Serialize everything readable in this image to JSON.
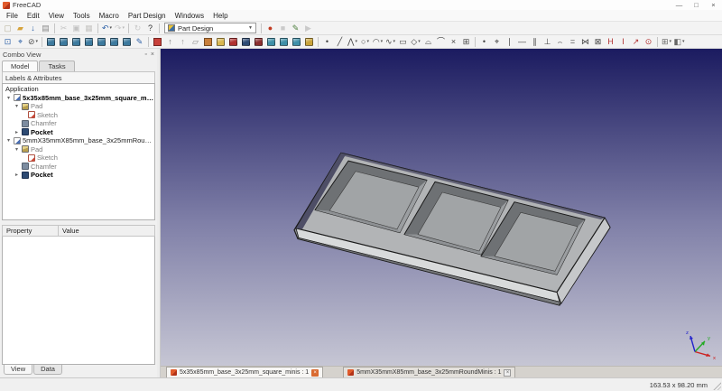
{
  "window": {
    "title": "FreeCAD",
    "controls": {
      "minimize": "—",
      "maximize": "□",
      "close": "×"
    }
  },
  "menu": {
    "items": [
      "File",
      "Edit",
      "View",
      "Tools",
      "Macro",
      "Part Design",
      "Windows",
      "Help"
    ]
  },
  "toolbars": {
    "workbench_value": "Part Design",
    "row1": [
      {
        "name": "new-file",
        "icon": "new-file-icon",
        "glyph": "▢",
        "color": "#b8b29a"
      },
      {
        "name": "open-file",
        "icon": "open-folder-icon",
        "glyph": "▰",
        "color": "#d6a33c"
      },
      {
        "name": "save",
        "icon": "save-icon",
        "glyph": "↓",
        "color": "#2f62a8"
      },
      {
        "name": "print",
        "icon": "print-icon",
        "glyph": "▤",
        "color": "#8a8a8a"
      },
      {
        "sep": true
      },
      {
        "name": "cut",
        "icon": "scissors-icon",
        "glyph": "✂",
        "color": "#777777",
        "disabled": true
      },
      {
        "name": "copy",
        "icon": "copy-icon",
        "glyph": "▣",
        "color": "#777777",
        "disabled": true
      },
      {
        "name": "paste",
        "icon": "paste-icon",
        "glyph": "▦",
        "color": "#8d7a55",
        "disabled": true
      },
      {
        "sep": true
      },
      {
        "name": "undo",
        "icon": "undo-arrow-icon",
        "glyph": "↶",
        "color": "#2f62a8",
        "dropdown": true
      },
      {
        "name": "redo",
        "icon": "redo-arrow-icon",
        "glyph": "↷",
        "color": "#888888",
        "disabled": true,
        "dropdown": true
      },
      {
        "sep": true
      },
      {
        "name": "refresh",
        "icon": "refresh-icon",
        "glyph": "↻",
        "color": "#888888",
        "disabled": true
      },
      {
        "name": "whats-this",
        "icon": "help-cursor-icon",
        "glyph": "?",
        "color": "#333333"
      },
      {
        "sep": true
      },
      {
        "workbench": true
      },
      {
        "sep": true
      },
      {
        "name": "macro-record",
        "icon": "record-dot-icon",
        "glyph": "●",
        "color": "#c23b22"
      },
      {
        "name": "macro-stop",
        "icon": "stop-square-icon",
        "glyph": "■",
        "color": "#8a8a8a",
        "disabled": true
      },
      {
        "name": "macro-edit",
        "icon": "pencil-icon",
        "glyph": "✎",
        "color": "#4a7d3a"
      },
      {
        "name": "macro-play",
        "icon": "play-triangle-icon",
        "glyph": "▶",
        "color": "#8a8a8a",
        "disabled": true
      }
    ],
    "row2": [
      {
        "name": "fit-all",
        "icon": "fit-all-icon",
        "glyph": "⊡",
        "color": "#2f62a8"
      },
      {
        "name": "fit-selection",
        "icon": "fit-selection-icon",
        "glyph": "⌖",
        "color": "#2f62a8"
      },
      {
        "name": "draw-style",
        "icon": "draw-style-icon",
        "glyph": "⊘",
        "color": "#555555",
        "dropdown": true
      },
      {
        "sep": true
      },
      {
        "name": "view-isometric",
        "icon": "isometric-cube-icon",
        "kind": "cube",
        "color": "#3d7a9e"
      },
      {
        "name": "view-front",
        "icon": "front-view-cube-icon",
        "kind": "cube",
        "color": "#3d7a9e"
      },
      {
        "name": "view-top",
        "icon": "top-view-cube-icon",
        "kind": "cube",
        "color": "#3d7a9e"
      },
      {
        "name": "view-right",
        "icon": "right-view-cube-icon",
        "kind": "cube",
        "color": "#3d7a9e"
      },
      {
        "name": "view-rear",
        "icon": "rear-view-cube-icon",
        "kind": "cube",
        "color": "#3d7a9e"
      },
      {
        "name": "view-bottom",
        "icon": "bottom-view-cube-icon",
        "kind": "cube",
        "color": "#3d7a9e"
      },
      {
        "name": "view-left",
        "icon": "left-view-cube-icon",
        "kind": "cube",
        "color": "#3d7a9e"
      },
      {
        "name": "measure-distance",
        "icon": "measure-icon",
        "glyph": "✎",
        "color": "#2f62a8"
      },
      {
        "sep": true
      },
      {
        "name": "create-sketch",
        "icon": "sketch-icon",
        "kind": "swatch",
        "color": "#c8413b"
      },
      {
        "name": "leave-sketch",
        "icon": "leave-sketch-arrow-icon",
        "glyph": "↑",
        "color": "#777777"
      },
      {
        "name": "view-sketch",
        "icon": "view-sketch-arrow-icon",
        "glyph": "↑",
        "color": "#9a9a9a"
      },
      {
        "name": "map-sketch",
        "icon": "map-sketch-icon",
        "glyph": "▱",
        "color": "#888888"
      },
      {
        "name": "reorient-sketch",
        "icon": "reorient-sketch-icon",
        "kind": "swatch",
        "color": "#c87f3b"
      },
      {
        "name": "pad",
        "icon": "pad-icon",
        "kind": "cube",
        "color": "#d9b64f"
      },
      {
        "name": "revolution",
        "icon": "revolution-icon",
        "kind": "cube",
        "color": "#b03030"
      },
      {
        "name": "pocket",
        "icon": "pocket-icon",
        "kind": "cube",
        "color": "#2d4a73"
      },
      {
        "name": "groove",
        "icon": "groove-icon",
        "kind": "cube",
        "color": "#8c2f2f"
      },
      {
        "name": "mirrored",
        "icon": "mirrored-icon",
        "kind": "cube",
        "color": "#3f8fa8"
      },
      {
        "name": "linear-pattern",
        "icon": "linear-pattern-icon",
        "kind": "cube",
        "color": "#3f8fa8"
      },
      {
        "name": "polar-pattern",
        "icon": "polar-pattern-icon",
        "kind": "cube",
        "color": "#3f8fa8"
      },
      {
        "name": "multitransform",
        "icon": "multitransform-icon",
        "kind": "cube",
        "color": "#c9a33a"
      },
      {
        "sep": true
      },
      {
        "name": "sketch-point",
        "icon": "point-icon",
        "glyph": "•",
        "color": "#444444"
      },
      {
        "name": "sketch-line",
        "icon": "line-icon",
        "glyph": "╱",
        "color": "#444444"
      },
      {
        "name": "sketch-polyline",
        "icon": "polyline-icon",
        "glyph": "⋀",
        "color": "#444444",
        "dropdown": true
      },
      {
        "name": "sketch-circle",
        "icon": "circle-icon",
        "glyph": "○",
        "color": "#444444",
        "dropdown": true
      },
      {
        "name": "sketch-arc",
        "icon": "arc-icon",
        "glyph": "◠",
        "color": "#444444",
        "dropdown": true
      },
      {
        "name": "sketch-bspline",
        "icon": "bspline-icon",
        "glyph": "∿",
        "color": "#444444",
        "dropdown": true
      },
      {
        "name": "sketch-rectangle",
        "icon": "rectangle-icon",
        "glyph": "▭",
        "color": "#444444"
      },
      {
        "name": "sketch-polygon",
        "icon": "polygon-icon",
        "glyph": "◇",
        "color": "#444444",
        "dropdown": true
      },
      {
        "name": "sketch-slot",
        "icon": "slot-icon",
        "glyph": "⌓",
        "color": "#444444"
      },
      {
        "name": "sketch-fillet",
        "icon": "fillet-icon",
        "glyph": "⌒",
        "color": "#444444"
      },
      {
        "name": "sketch-trim",
        "icon": "trim-icon",
        "glyph": "×",
        "color": "#444444"
      },
      {
        "name": "external-geometry",
        "icon": "external-geometry-icon",
        "glyph": "⊞",
        "color": "#444444"
      },
      {
        "sep": true
      },
      {
        "name": "constraint-coincident",
        "icon": "coincident-icon",
        "glyph": "•",
        "color": "#444444"
      },
      {
        "name": "constraint-point-on-object",
        "icon": "point-on-object-icon",
        "glyph": "⌖",
        "color": "#444444"
      },
      {
        "name": "constraint-vertical",
        "icon": "vertical-constraint-icon",
        "glyph": "∣",
        "color": "#444444"
      },
      {
        "name": "constraint-horizontal",
        "icon": "horizontal-constraint-icon",
        "glyph": "—",
        "color": "#444444"
      },
      {
        "name": "constraint-parallel",
        "icon": "parallel-icon",
        "glyph": "∥",
        "color": "#444444"
      },
      {
        "name": "constraint-perpendicular",
        "icon": "perpendicular-icon",
        "glyph": "⊥",
        "color": "#444444"
      },
      {
        "name": "constraint-tangent",
        "icon": "tangent-icon",
        "glyph": "⌢",
        "color": "#444444"
      },
      {
        "name": "constraint-equal",
        "icon": "equal-icon",
        "glyph": "=",
        "color": "#444444"
      },
      {
        "name": "constraint-symmetric",
        "icon": "symmetric-icon",
        "glyph": "⋈",
        "color": "#444444"
      },
      {
        "name": "constraint-lock",
        "icon": "lock-icon",
        "glyph": "⊠",
        "color": "#444444"
      },
      {
        "name": "constraint-horizontal-distance",
        "icon": "h-distance-icon",
        "glyph": "H",
        "color": "#b03030"
      },
      {
        "name": "constraint-vertical-distance",
        "icon": "v-distance-icon",
        "glyph": "I",
        "color": "#b03030"
      },
      {
        "name": "constraint-distance",
        "icon": "distance-icon",
        "glyph": "↗",
        "color": "#b03030"
      },
      {
        "name": "constraint-radius",
        "icon": "radius-icon",
        "glyph": "⊙",
        "color": "#b03030"
      },
      {
        "sep": true
      },
      {
        "name": "toggle-grid",
        "icon": "grid-icon",
        "glyph": "⊞",
        "color": "#666666",
        "dropdown": true
      },
      {
        "name": "select-mode",
        "icon": "select-mode-icon",
        "glyph": "◧",
        "color": "#666666",
        "dropdown": true
      }
    ]
  },
  "combo_view": {
    "title": "Combo View",
    "header_icons": {
      "float": "▫",
      "close": "×"
    },
    "tabs": [
      "Model",
      "Tasks"
    ],
    "tree_header": "Labels & Attributes",
    "root_label": "Application",
    "documents": [
      {
        "name": "5x35x85mm_base_3x25mm_square_minis",
        "active": true,
        "features": [
          {
            "label": "Pad"
          },
          {
            "label": "Sketch"
          },
          {
            "label": "Chamfer"
          },
          {
            "label": "Pocket"
          }
        ]
      },
      {
        "name": "5mmX35mmX85mm_base_3x25mmRoundMinis",
        "active": false,
        "features": [
          {
            "label": "Pad"
          },
          {
            "label": "Sketch"
          },
          {
            "label": "Chamfer"
          },
          {
            "label": "Pocket"
          }
        ]
      }
    ],
    "property_panel": {
      "columns": [
        "Property",
        "Value"
      ]
    },
    "bottom_tabs": [
      "View",
      "Data"
    ]
  },
  "viewport": {
    "gradient": {
      "top": "#1b1b60",
      "mid": "#8080a8",
      "bottom": "#c6c6d4"
    },
    "model_colors": {
      "top": "#b2b4b6",
      "side": "#8f9294",
      "end": "#c6c8ca",
      "chamfer": "#d8dadb",
      "bottom_strip": "#77797c",
      "back_edge": "#4e4e66",
      "pocket_wall": "#6e7174",
      "pocket_wall_light": "#9b9ea1",
      "pocket_wall_bottom": "#8e9194",
      "pocket_floor": "#a1a4a6",
      "outline": "#1a1a1a"
    },
    "axis": {
      "x": "x",
      "y": "y",
      "z": "z"
    },
    "axis_colors": {
      "x": "#cc2222",
      "y": "#22aa22",
      "z": "#2222cc"
    }
  },
  "mdi": {
    "tabs": [
      {
        "label": "5x35x85mm_base_3x25mm_square_minis : 1",
        "active": true
      },
      {
        "label": "5mmX35mmX85mm_base_3x25mmRoundMinis : 1",
        "active": false
      }
    ]
  },
  "status_bar": {
    "dimensions": "163.53 x 98.20 mm"
  }
}
